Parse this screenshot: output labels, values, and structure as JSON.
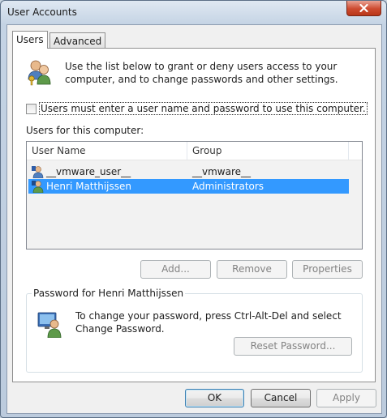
{
  "window": {
    "title": "User Accounts"
  },
  "tabs": [
    {
      "label": "Users",
      "active": true
    },
    {
      "label": "Advanced",
      "active": false
    }
  ],
  "intro": {
    "text": "Use the list below to grant or deny users access to your computer, and to change passwords and other settings."
  },
  "require_login": {
    "label": "Users must enter a user name and password to use this computer.",
    "checked": false
  },
  "users_list": {
    "label": "Users for this computer:",
    "columns": [
      "User Name",
      "Group"
    ],
    "rows": [
      {
        "user": "__vmware_user__",
        "group": "__vmware__",
        "selected": false
      },
      {
        "user": "Henri Matthijssen",
        "group": "Administrators",
        "selected": true
      }
    ]
  },
  "list_buttons": {
    "add": "Add...",
    "remove": "Remove",
    "properties": "Properties"
  },
  "password_group": {
    "title": "Password for Henri Matthijssen",
    "text": "To change your password, press Ctrl-Alt-Del and select Change Password.",
    "reset_button": "Reset Password..."
  },
  "dialog_buttons": {
    "ok": "OK",
    "cancel": "Cancel",
    "apply": "Apply"
  },
  "colors": {
    "selection": "#3399ff",
    "close_button": "#cd4b30"
  }
}
